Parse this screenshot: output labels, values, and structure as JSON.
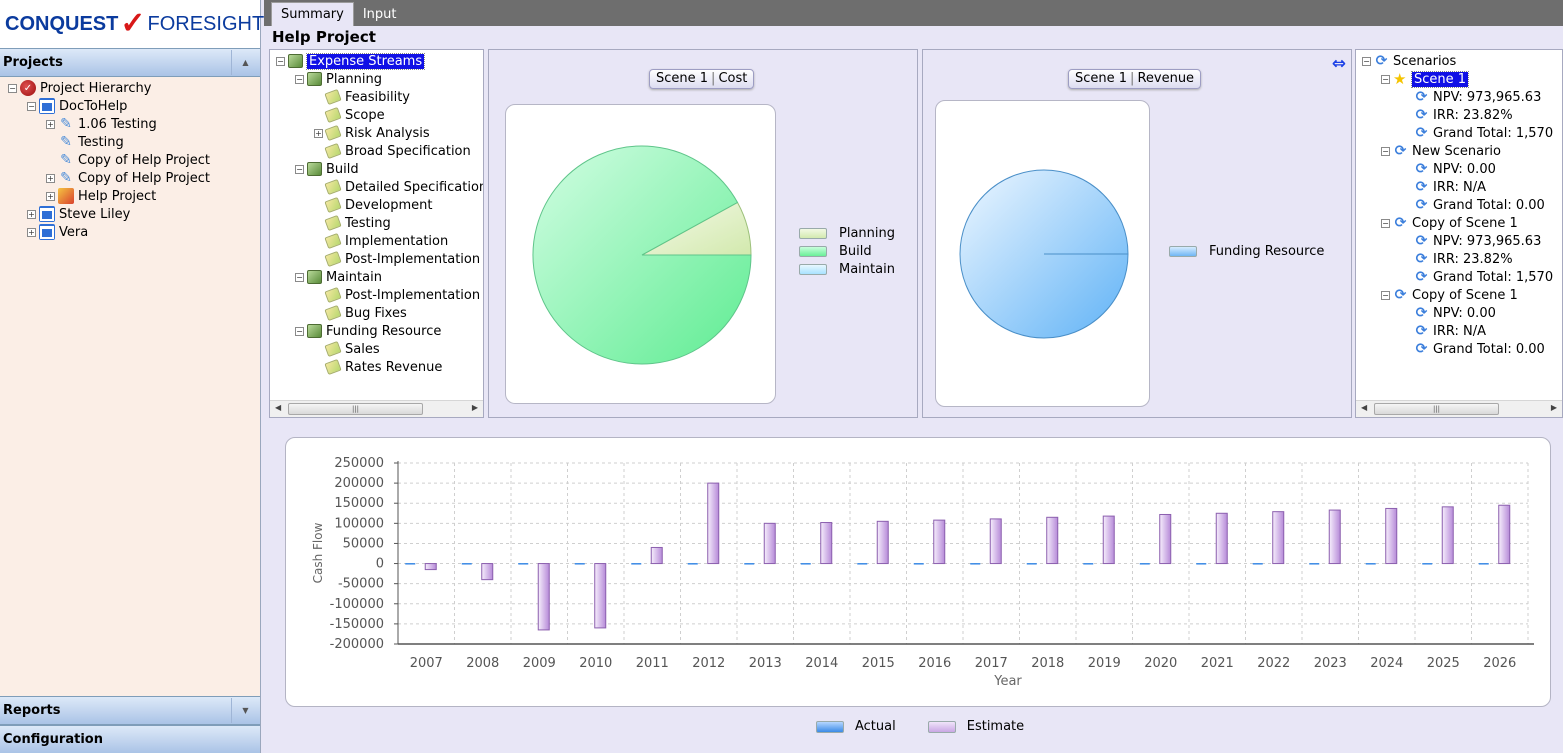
{
  "logo": {
    "name_part1": "CONQUEST",
    "name_part2": "FORESIGHT"
  },
  "sidebar": {
    "projects_label": "Projects",
    "reports_label": "Reports",
    "configuration_label": "Configuration",
    "tree": [
      {
        "label": "Project Hierarchy",
        "icon": "hierarchy-check-icon"
      },
      {
        "label": "DocToHelp",
        "icon": "org-icon"
      },
      {
        "label": "1.06 Testing",
        "icon": "project-icon"
      },
      {
        "label": "Testing",
        "icon": "project-icon"
      },
      {
        "label": "Copy of Help Project",
        "icon": "project-icon"
      },
      {
        "label": "Copy of Help Project",
        "icon": "project-icon"
      },
      {
        "label": "Help Project",
        "icon": "active-project-icon"
      },
      {
        "label": "Steve Liley",
        "icon": "org-icon"
      },
      {
        "label": "Vera",
        "icon": "org-icon"
      }
    ]
  },
  "tabs": {
    "summary": "Summary",
    "input": "Input"
  },
  "page_title": "Help Project",
  "streams": {
    "root": "Expense Streams",
    "items": [
      {
        "label": "Planning",
        "kind": "group"
      },
      {
        "label": "Feasibility",
        "kind": "leaf"
      },
      {
        "label": "Scope",
        "kind": "leaf"
      },
      {
        "label": "Risk Analysis",
        "kind": "leaf"
      },
      {
        "label": "Broad Specification",
        "kind": "leaf"
      },
      {
        "label": "Build",
        "kind": "group"
      },
      {
        "label": "Detailed Specification",
        "kind": "leaf"
      },
      {
        "label": "Development",
        "kind": "leaf"
      },
      {
        "label": "Testing",
        "kind": "leaf"
      },
      {
        "label": "Implementation",
        "kind": "leaf"
      },
      {
        "label": "Post-Implementation",
        "kind": "leaf"
      },
      {
        "label": "Maintain",
        "kind": "group"
      },
      {
        "label": "Post-Implementation",
        "kind": "leaf"
      },
      {
        "label": "Bug Fixes",
        "kind": "leaf"
      },
      {
        "label": "Funding Resource",
        "kind": "group"
      },
      {
        "label": "Sales",
        "kind": "leaf"
      },
      {
        "label": "Rates Revenue",
        "kind": "leaf"
      }
    ]
  },
  "scenarios": {
    "root": "Scenarios",
    "groups": [
      {
        "name": "Scene 1",
        "selected": true,
        "npv": "NPV: 973,965.63",
        "irr": "IRR: 23.82%",
        "total": "Grand Total: 1,570"
      },
      {
        "name": "New Scenario",
        "selected": false,
        "npv": "NPV: 0.00",
        "irr": "IRR: N/A",
        "total": "Grand Total: 0.00"
      },
      {
        "name": "Copy of Scene 1",
        "selected": false,
        "npv": "NPV: 973,965.63",
        "irr": "IRR: 23.82%",
        "total": "Grand Total: 1,570"
      },
      {
        "name": "Copy of Scene 1",
        "selected": false,
        "npv": "NPV: 0.00",
        "irr": "IRR: N/A",
        "total": "Grand Total: 0.00"
      }
    ]
  },
  "cost_chart": {
    "scene": "Scene 1",
    "kind": "Cost"
  },
  "revenue_chart": {
    "scene": "Scene 1",
    "kind": "Revenue"
  },
  "colors": {
    "planning": "#dff0c4",
    "build": "#7ef2a6",
    "maintain": "#bfeaff",
    "funding": "#8cc8f8",
    "actual": "#3b8ae6",
    "estimate": "#c9a7e4"
  },
  "chart_data": [
    {
      "type": "pie",
      "title": "",
      "labels": [
        "Planning",
        "Build",
        "Maintain"
      ],
      "values": [
        8,
        92,
        0
      ]
    },
    {
      "type": "pie",
      "title": "",
      "labels": [
        "Funding Resource"
      ],
      "values": [
        100
      ]
    },
    {
      "type": "bar",
      "title": "",
      "xlabel": "Year",
      "ylabel": "Cash Flow",
      "ylim": [
        -200000,
        250000
      ],
      "yticks": [
        "250000",
        "200000",
        "150000",
        "100000",
        "50000",
        "0",
        "-50000",
        "-100000",
        "-150000",
        "-200000"
      ],
      "categories": [
        "2007",
        "2008",
        "2009",
        "2010",
        "2011",
        "2012",
        "2013",
        "2014",
        "2015",
        "2016",
        "2017",
        "2018",
        "2019",
        "2020",
        "2021",
        "2022",
        "2023",
        "2024",
        "2025",
        "2026"
      ],
      "series": [
        {
          "name": "Actual",
          "values": [
            0,
            0,
            0,
            0,
            0,
            0,
            0,
            0,
            0,
            0,
            0,
            0,
            0,
            0,
            0,
            0,
            0,
            0,
            0,
            0
          ]
        },
        {
          "name": "Estimate",
          "values": [
            -15000,
            -40000,
            -165000,
            -160000,
            40000,
            200000,
            100000,
            102000,
            105000,
            108000,
            111000,
            115000,
            118000,
            122000,
            125000,
            129000,
            133000,
            137000,
            141000,
            145000
          ]
        }
      ],
      "grid": true,
      "legend": "bottom"
    }
  ]
}
